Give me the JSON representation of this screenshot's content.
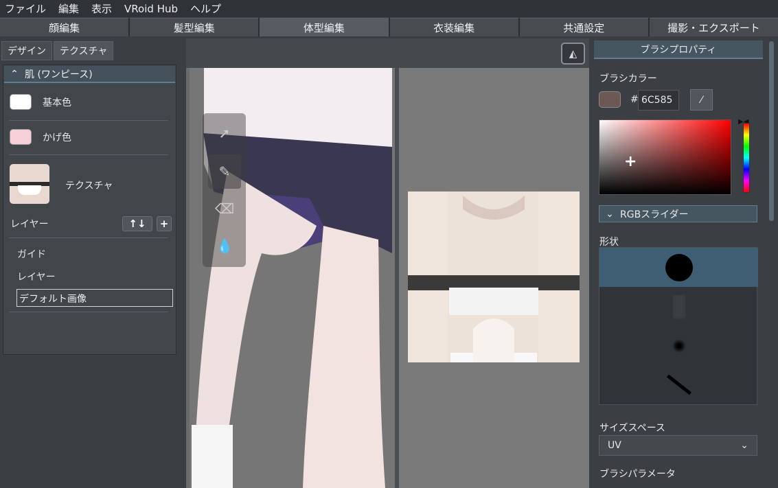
{
  "menu": [
    "ファイル",
    "編集",
    "表示",
    "VRoid Hub",
    "ヘルプ"
  ],
  "tabs": [
    "顔編集",
    "髪型編集",
    "体型編集",
    "衣装編集",
    "共通設定",
    "撮影・エクスポート"
  ],
  "left": {
    "subtabs": [
      "デザイン",
      "テクスチャ"
    ],
    "section_title": "肌 (ワンピース)",
    "base_color_label": "基本色",
    "shade_color_label": "かげ色",
    "texture_label": "テクスチャ",
    "layer_label": "レイヤー",
    "layers": [
      "ガイド",
      "レイヤー"
    ],
    "selected_layer": "デフォルト画像",
    "base_color": "#ffffff",
    "shade_color": "#f7cfd9"
  },
  "right": {
    "title": "ブラシプロパティ",
    "brush_color_label": "ブラシカラー",
    "hash": "#",
    "hex_value": "6C585",
    "rgb_slider_label": "RGBスライダー",
    "shape_label": "形状",
    "size_space_label": "サイズスペース",
    "size_space_value": "UV",
    "brush_params_label": "ブラシパラメータ"
  }
}
